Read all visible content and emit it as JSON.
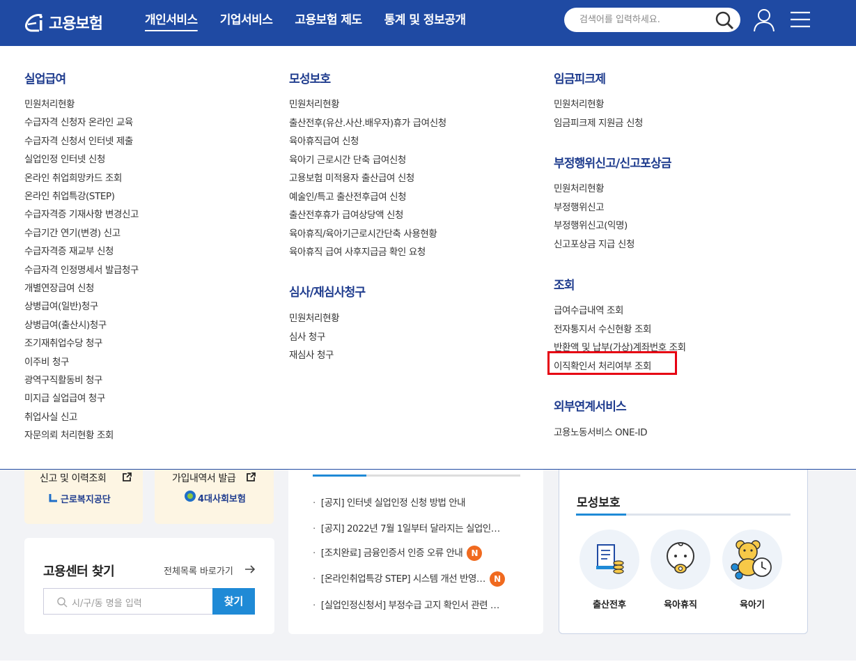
{
  "header": {
    "logo_text": "고용보험",
    "nav": [
      "개인서비스",
      "기업서비스",
      "고용보험 제도",
      "통계 및 정보공개"
    ],
    "search_placeholder": "검색어를 입력하세요."
  },
  "menu": {
    "col1": {
      "title": "실업급여",
      "items": [
        "민원처리현황",
        "수급자격 신청자 온라인 교육",
        "수급자격 신청서 인터넷 제출",
        "실업인정 인터넷 신청",
        "온라인 취업희망카드 조회",
        "온라인 취업특강(STEP)",
        "수급자격증 기재사항 변경신고",
        "수급기간 연기(변경) 신고",
        "수급자격증 재교부 신청",
        "수급자격 인정명세서 발급청구",
        "개별연장급여 신청",
        "상병급여(일반)청구",
        "상병급여(출산시)청구",
        "조기재취업수당 청구",
        "이주비 청구",
        "광역구직활동비 청구",
        "미지급 실업급여 청구",
        "취업사실 신고",
        "자문의뢰 처리현황 조회"
      ]
    },
    "col2a": {
      "title": "모성보호",
      "items": [
        "민원처리현황",
        "출산전후(유산.사산.배우자)휴가 급여신청",
        "육아휴직급여 신청",
        "육아기 근로시간 단축 급여신청",
        "고용보험 미적용자 출산급여 신청",
        "예술인/특고 출산전후급여 신청",
        "출산전후휴가 급여상당액 신청",
        "육아휴직/육아기근로시간단축 사용현황",
        "육아휴직 급여 사후지급금 확인 요청"
      ]
    },
    "col2b": {
      "title": "심사/재심사청구",
      "items": [
        "민원처리현황",
        "심사 청구",
        "재심사 청구"
      ]
    },
    "col3a": {
      "title": "임금피크제",
      "items": [
        "민원처리현황",
        "임금피크제 지원금 신청"
      ]
    },
    "col3b": {
      "title": "부정행위신고/신고포상금",
      "items": [
        "민원처리현황",
        "부정행위신고",
        "부정행위신고(익명)",
        "신고포상금 지급 신청"
      ]
    },
    "col3c": {
      "title": "조회",
      "items": [
        "급여수급내역 조회",
        "전자통지서 수신현황 조회",
        "반환액 및 납부(가상)계좌번호 조회",
        "이직확인서 처리여부 조회"
      ]
    },
    "col3d": {
      "title": "외부연계서비스",
      "items": [
        "고용노동서비스 ONE-ID"
      ]
    }
  },
  "below": {
    "shortcut1": {
      "label": "신고 및 이력조회",
      "org": "근로복지공단"
    },
    "shortcut2": {
      "label": "가입내역서 발급",
      "org": "4대사회보험"
    },
    "center": {
      "title": "고용센터 찾기",
      "all_link": "전체목록 바로가기",
      "placeholder": "시/구/동 명을 입력",
      "button": "찾기"
    },
    "notices": [
      {
        "text": "[공지] 인터넷 실업인정 신청 방법 안내",
        "new": false
      },
      {
        "text": "[공지] 2022년 7월 1일부터 달라지는 실업인…",
        "new": false
      },
      {
        "text": "[조치완료] 금융인증서 인증 오류 안내",
        "new": true
      },
      {
        "text": "[온라인취업특강 STEP] 시스템 개선 반영…",
        "new": true
      },
      {
        "text": "[실업인정신청서] 부정수급 고지 확인서 관련 …",
        "new": false
      }
    ],
    "new_badge": "N",
    "maternity": {
      "title": "모성보호",
      "items": [
        "출산전후",
        "육아휴직",
        "육아기"
      ]
    }
  },
  "colors": {
    "brand": "#1f4aa3",
    "menu_title": "#1f3c8e",
    "highlight": "#e60012",
    "new_badge": "#f06a1f"
  }
}
